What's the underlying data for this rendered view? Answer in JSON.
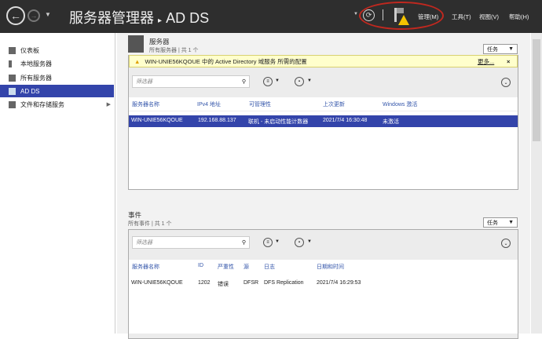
{
  "header": {
    "title": "服务器管理器",
    "breadcrumb_sep": "▸",
    "page": "AD DS",
    "menus": [
      "管理(M)",
      "工具(T)",
      "视图(V)",
      "帮助(H)"
    ]
  },
  "sidebar": {
    "items": [
      {
        "label": "仪表板"
      },
      {
        "label": "本地服务器"
      },
      {
        "label": "所有服务器"
      },
      {
        "label": "AD DS"
      },
      {
        "label": "文件和存储服务"
      }
    ]
  },
  "servers": {
    "title": "服务器",
    "subtitle": "所有服务器 | 共 1 个",
    "tasks": "任务",
    "banner": "WIN-UNIE56KQOUE 中的 Active Directory 域服务 所需的配置",
    "banner_more": "更多...",
    "filter_placeholder": "筛选器",
    "columns": [
      "服务器名称",
      "IPv4 地址",
      "可管理性",
      "上次更新",
      "Windows 激活"
    ],
    "rows": [
      [
        "WIN-UNIE56KQOUE",
        "192.168.88.137",
        "联机 - 未启动性能计数器",
        "2021/7/4 16:30:48",
        "未激活"
      ]
    ]
  },
  "events": {
    "title": "事件",
    "subtitle": "所有事件 | 共 1 个",
    "tasks": "任务",
    "filter_placeholder": "筛选器",
    "columns": [
      "服务器名称",
      "ID",
      "严重性",
      "源",
      "日志",
      "日期和时间"
    ],
    "rows": [
      [
        "WIN-UNIE56KQOUE",
        "1202",
        "错误",
        "DFSR",
        "DFS Replication",
        "2021/7/4 16:29:53"
      ]
    ]
  },
  "colors": {
    "accent": "#3344aa",
    "topbar": "#2e2e2e",
    "banner": "#ffffcc"
  }
}
